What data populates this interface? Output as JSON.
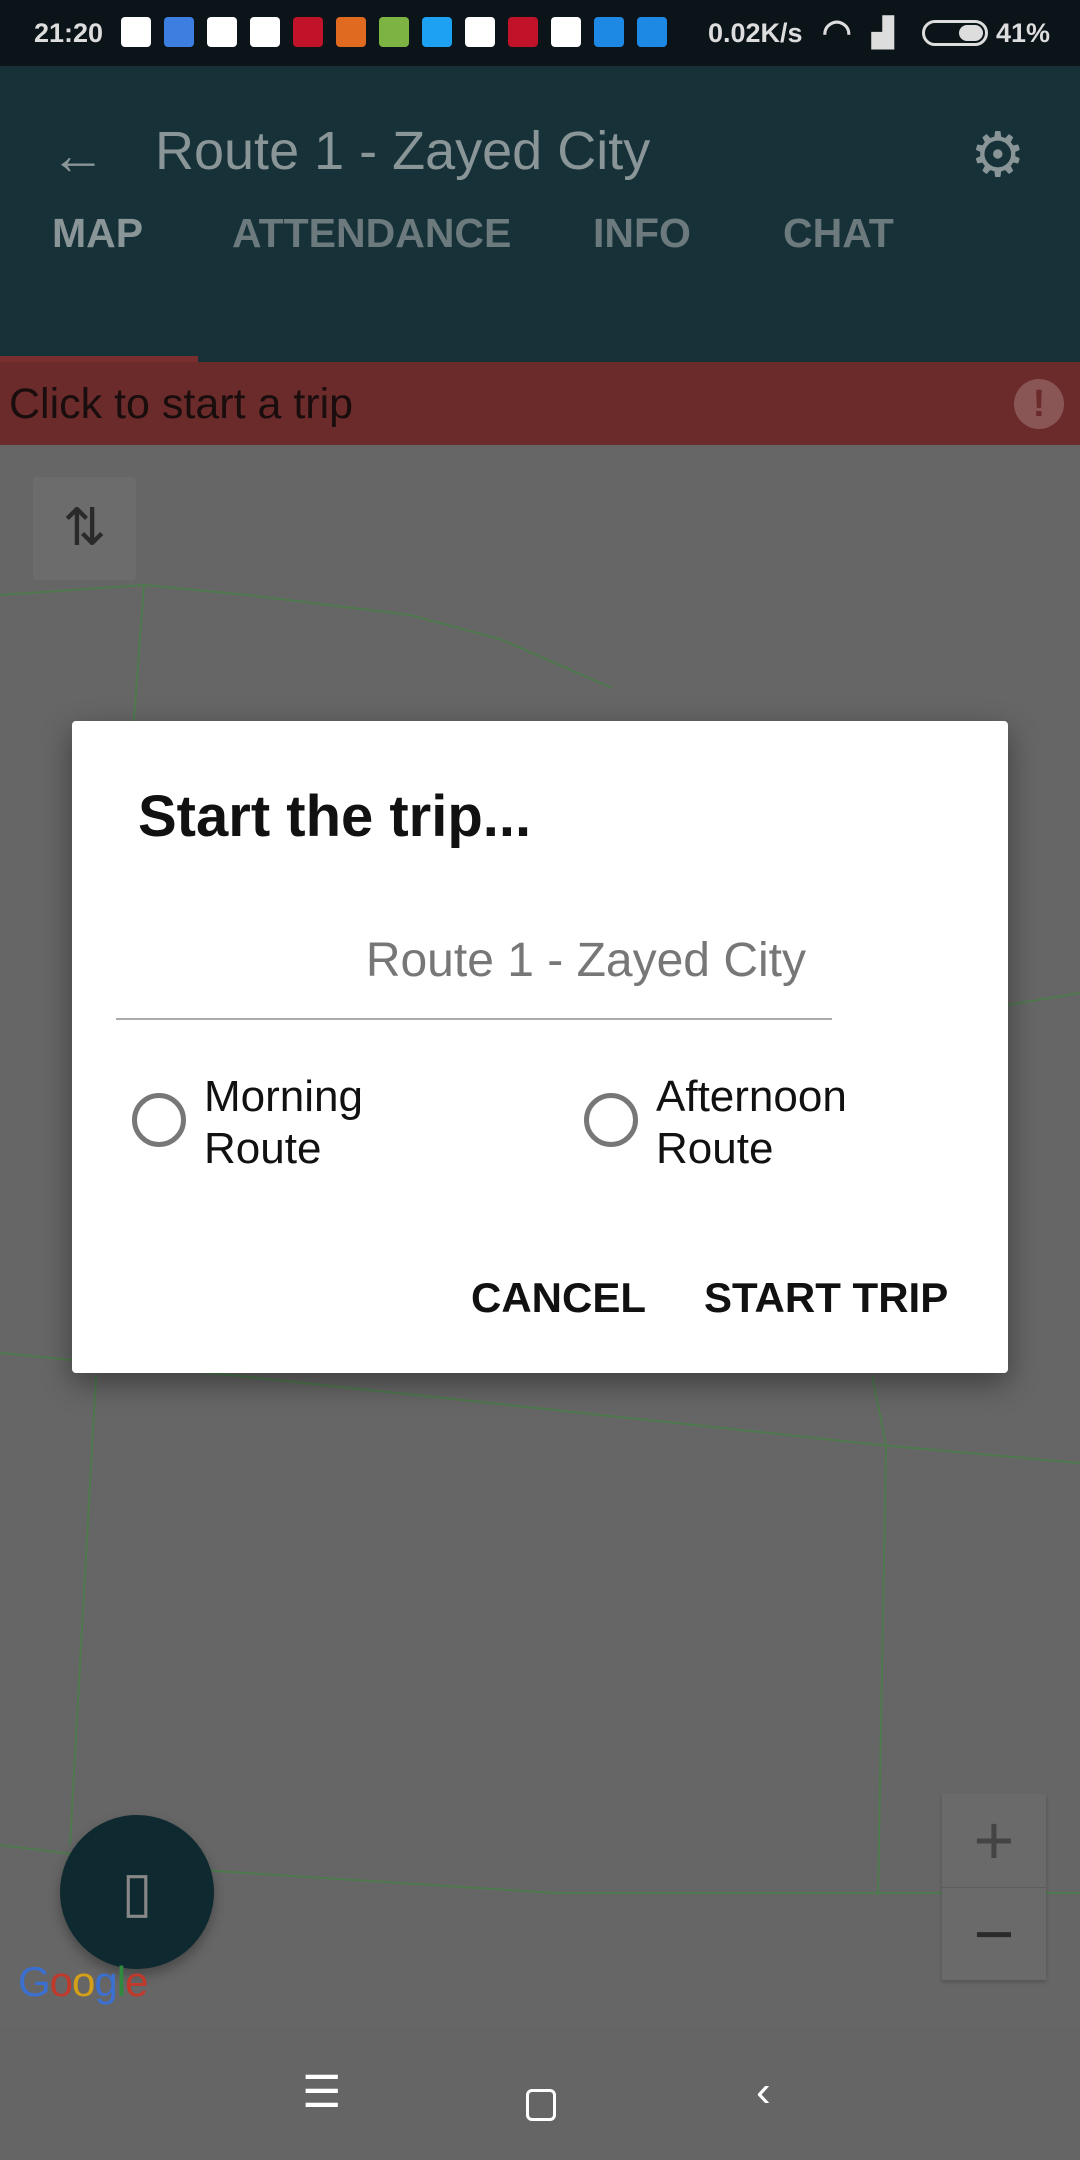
{
  "status_bar": {
    "time": "21:20",
    "speed": "0.02K/s",
    "battery": "41%",
    "notification_icons": [
      "whatsapp-icon",
      "cloud-icon",
      "gmail-icon",
      "google-icon",
      "pinterest-icon",
      "shield-icon",
      "download-icon",
      "twitter-icon",
      "gmail-icon",
      "pinterest-icon",
      "linkedin-icon",
      "mi-icon",
      "mi-icon"
    ]
  },
  "app_bar": {
    "title": "Route 1 - Zayed City",
    "back_icon": "arrow-left-icon",
    "settings_icon": "gear-icon"
  },
  "tabs": [
    {
      "label": "MAP",
      "active": true
    },
    {
      "label": "ATTENDANCE"
    },
    {
      "label": "INFO"
    },
    {
      "label": "CHAT"
    }
  ],
  "banner": {
    "text": "Click to start a trip",
    "icon": "alert-icon"
  },
  "map": {
    "logo": "Google",
    "zoom_in": "+",
    "zoom_out": "−"
  },
  "dialog": {
    "title": "Start the trip...",
    "route_value": "Route 1 - Zayed City",
    "options": [
      {
        "line1": "Morning",
        "line2": "Route",
        "selected": false
      },
      {
        "line1": "Afternoon",
        "line2": "Route",
        "selected": false
      }
    ],
    "cancel": "CANCEL",
    "start": "START TRIP"
  },
  "colors": {
    "app_bar": "#163238",
    "banner": "#6b2b2b",
    "map_lines": "#4e7a4e"
  }
}
